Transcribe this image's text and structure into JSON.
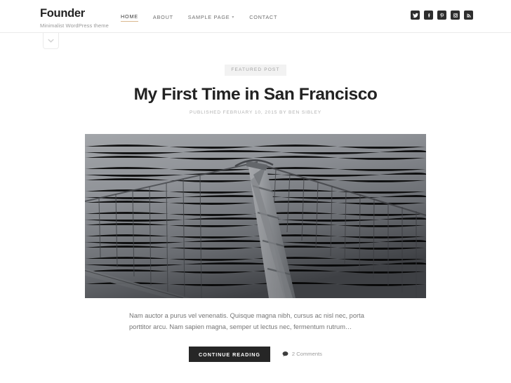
{
  "header": {
    "site_title": "Founder",
    "tagline": "Minimalist WordPress theme",
    "nav": [
      {
        "label": "HOME",
        "active": true,
        "has_dropdown": false
      },
      {
        "label": "ABOUT",
        "active": false,
        "has_dropdown": false
      },
      {
        "label": "SAMPLE PAGE",
        "active": false,
        "has_dropdown": true
      },
      {
        "label": "CONTACT",
        "active": false,
        "has_dropdown": false
      }
    ],
    "social": [
      {
        "name": "twitter-icon",
        "title": "Twitter"
      },
      {
        "name": "facebook-icon",
        "title": "Facebook"
      },
      {
        "name": "pinterest-icon",
        "title": "Pinterest"
      },
      {
        "name": "instagram-icon",
        "title": "Instagram"
      },
      {
        "name": "rss-icon",
        "title": "RSS"
      }
    ],
    "active_underline_color": "#dbb98f",
    "toggle_glyph": "⌄"
  },
  "post": {
    "badge": "FEATURED POST",
    "title": "My First Time in San Francisco",
    "meta": "PUBLISHED FEBRUARY 10, 2015 BY BEN SIBLEY",
    "featured_image_alt": "Aerial black and white photo of the Golden Gate Bridge tower and suspension cables over water",
    "excerpt": "Nam auctor a purus vel venenatis. Quisque magna nibh, cursus ac nisl nec, porta porttitor arcu. Nam sapien magna, semper ut lectus nec, fermentum rutrum…",
    "continue_label": "CONTINUE READING",
    "comments_label": "2 Comments"
  },
  "colors": {
    "accent": "#dbb98f",
    "button_bg": "#262626",
    "badge_bg": "#f2f2f2",
    "text_muted": "#9d9d9d"
  }
}
